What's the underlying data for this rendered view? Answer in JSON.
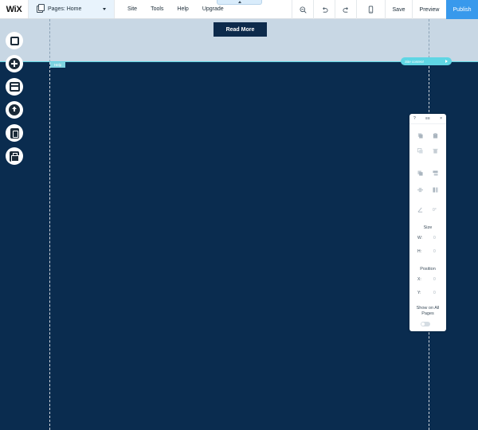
{
  "topbar": {
    "logo": "WiX",
    "pages_label": "Pages: Home",
    "menu": [
      "Site",
      "Tools",
      "Help",
      "Upgrade"
    ],
    "save_label": "Save",
    "preview_label": "Preview",
    "publish_label": "Publish",
    "icons": [
      "zoom-out-icon",
      "undo-icon",
      "redo-icon",
      "mobile-icon"
    ]
  },
  "canvas": {
    "button_label": "Read More",
    "help_tag": "Help",
    "content_handle": "Site content",
    "colors": {
      "header": "#c8d7e4",
      "body": "#0a2c4f",
      "accent": "#5fd6e4",
      "publish": "#3899ec"
    }
  },
  "left_tools": [
    "background-icon",
    "add-icon",
    "store-icon",
    "upload-icon",
    "blog-icon",
    "app-market-icon"
  ],
  "panel": {
    "help": "?",
    "mid": "≡≡",
    "close": "×",
    "size_title": "Size",
    "w_label": "W:",
    "w_value": "0",
    "h_label": "H:",
    "h_value": "0",
    "position_title": "Position",
    "x_label": "X:",
    "x_value": "0",
    "y_label": "Y:",
    "y_value": "0",
    "rotate_value": "0°",
    "show_all": "Show on All Pages"
  }
}
